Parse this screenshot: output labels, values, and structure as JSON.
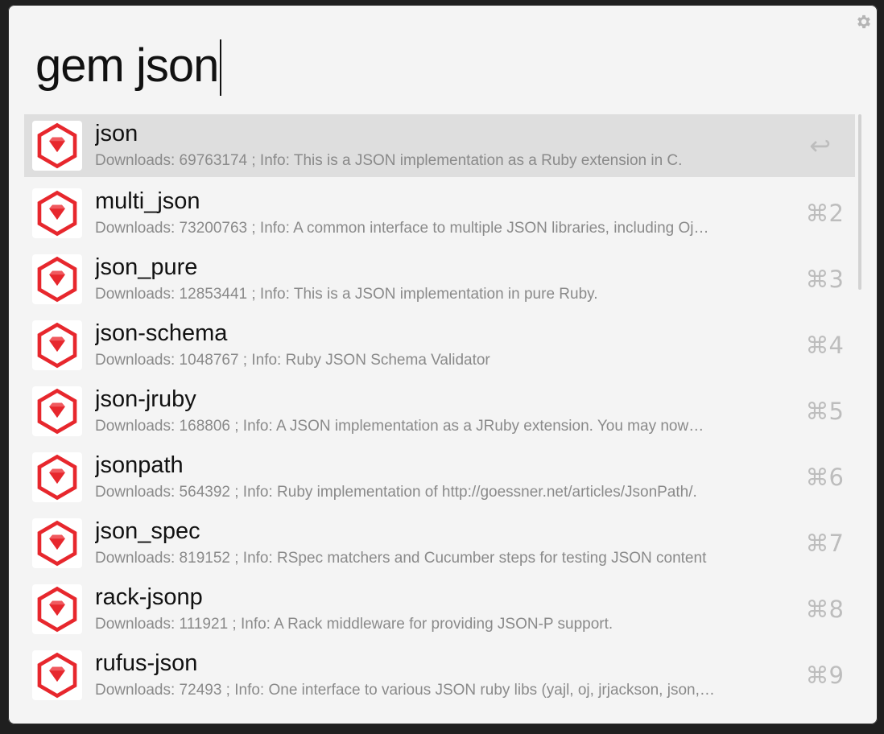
{
  "search": {
    "query": "gem json"
  },
  "colors": {
    "accent": "#e7272d",
    "selected_row": "#dedede",
    "window_bg": "#f4f4f4"
  },
  "icons": {
    "settings": "gear-icon",
    "result": "ruby-gem-icon",
    "return": "return-icon"
  },
  "results": [
    {
      "title": "json",
      "subtitle": "Downloads: 69763174 ; Info: This is a JSON implementation as a Ruby extension in C.",
      "shortcut": "↩"
    },
    {
      "title": "multi_json",
      "subtitle": "Downloads: 73200763 ; Info: A common interface to multiple JSON libraries, including Oj…",
      "shortcut": "⌘2"
    },
    {
      "title": "json_pure",
      "subtitle": "Downloads: 12853441 ; Info: This is a JSON implementation in pure Ruby.",
      "shortcut": "⌘3"
    },
    {
      "title": "json-schema",
      "subtitle": "Downloads: 1048767 ; Info: Ruby JSON Schema Validator",
      "shortcut": "⌘4"
    },
    {
      "title": "json-jruby",
      "subtitle": "Downloads: 168806 ; Info: A JSON implementation as a JRuby extension. You may now…",
      "shortcut": "⌘5"
    },
    {
      "title": "jsonpath",
      "subtitle": "Downloads: 564392 ; Info: Ruby implementation of http://goessner.net/articles/JsonPath/.",
      "shortcut": "⌘6"
    },
    {
      "title": "json_spec",
      "subtitle": "Downloads: 819152 ; Info: RSpec matchers and Cucumber steps for testing JSON content",
      "shortcut": "⌘7"
    },
    {
      "title": "rack-jsonp",
      "subtitle": "Downloads: 111921 ; Info: A Rack middleware for providing JSON-P support.",
      "shortcut": "⌘8"
    },
    {
      "title": "rufus-json",
      "subtitle": "Downloads: 72493 ; Info: One interface to various JSON ruby libs (yajl, oj, jrjackson, json,…",
      "shortcut": "⌘9"
    }
  ]
}
